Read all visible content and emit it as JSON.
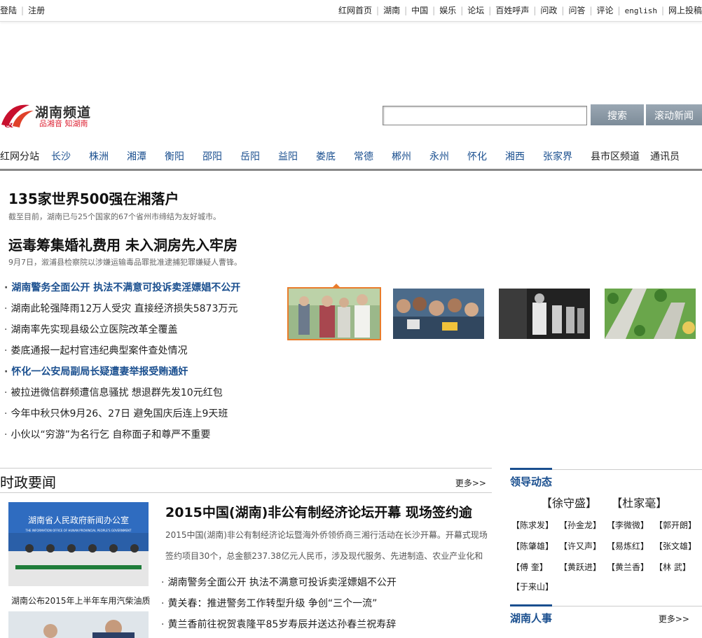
{
  "topbar": {
    "left": [
      "登陆",
      "注册"
    ],
    "right": [
      "红网首页",
      "湖南",
      "中国",
      "娱乐",
      "论坛",
      "百姓呼声",
      "问政",
      "问答",
      "评论",
      "english",
      "网上投稿"
    ]
  },
  "logo": {
    "title": "湖南频道",
    "slogan": "品湘音  知湖南"
  },
  "search": {
    "value": "",
    "search_btn": "搜索",
    "scroll_btn": "滚动新闻"
  },
  "citynav": {
    "label": "红网分站",
    "cities": [
      "长沙",
      "株洲",
      "湘潭",
      "衡阳",
      "邵阳",
      "岳阳",
      "益阳",
      "娄底",
      "常德",
      "郴州",
      "永州",
      "怀化",
      "湘西",
      "张家界"
    ],
    "extra": [
      "县市区频道",
      "通讯员"
    ]
  },
  "headlines": [
    {
      "title": "135家世界500强在湘落户",
      "sub": "截至目前，湖南已与25个国家的67个省州市缔结为友好城市。"
    },
    {
      "title": "运毒筹集婚礼费用 未入洞房先入牢房",
      "sub": "9月7日，溆浦县检察院以涉嫌运输毒品罪批准逮捕犯罪嫌疑人曹锋。"
    }
  ],
  "newslist": [
    {
      "text": "湖南警务全面公开  执法不满意可投诉卖淫嫖娼不公开",
      "highlight": true
    },
    {
      "text": "湖南此轮强降雨12万人受灾  直接经济损失5873万元",
      "highlight": false
    },
    {
      "text": "湖南率先实现县级公立医院改革全覆盖",
      "highlight": false
    },
    {
      "text": "娄底通报一起村官违纪典型案件查处情况",
      "highlight": false
    },
    {
      "text": "怀化一公安局副局长疑遭妻举报受贿通奸",
      "highlight": true
    },
    {
      "text": "被拉进微信群频遭信息骚扰  想退群先发10元红包",
      "highlight": false
    },
    {
      "text": "今年中秋只休9月26、27日  避免国庆后连上9天班",
      "highlight": false
    },
    {
      "text": "小伙以“穷游”为名行乞  自称面子和尊严不重要",
      "highlight": false
    }
  ],
  "section": {
    "title": "时政要闻",
    "more": "更多>>",
    "lead_title": "2015中国(湖南)非公有制经济论坛开幕  现场签约逾",
    "lead_body": "2015中国(湖南)非公有制经济论坛暨海外侨领侨商三湘行活动在长沙开幕。开幕式现场签约项目30个，总金额237.38亿元人民币，涉及现代服务、先进制造、农业产业化和",
    "photo_caption": "湖南公布2015年上半年车用汽柴油质",
    "list": [
      "湖南警务全面公开  执法不满意可投诉卖淫嫖娼不公开",
      "黄关春：推进警务工作转型升级  争创“三个一流”",
      "黄兰香前往祝贺袁隆平85岁寿辰并送达孙春兰祝寿辞"
    ],
    "photo_banner": "湖南省人民政府新闻办公室",
    "photo_banner_en": "THE INFORMATION OFFICE OF HUNAN PROVINCIAL PEOPLE'S GOVERNMENT"
  },
  "leaders": {
    "title": "领导动态",
    "big": [
      "【徐守盛】",
      "【杜家毫】"
    ],
    "names": [
      "【陈求发】",
      "【孙金龙】",
      "【李微微】",
      "【郭开朗】",
      "【陈肇雄】",
      "【许又声】",
      "【易炼红】",
      "【张文雄】",
      "【傅  奎】",
      "【黄跃进】",
      "【黄兰香】",
      "【林  武】",
      "【于来山】"
    ]
  },
  "personnel": {
    "title": "湖南人事",
    "more": "更多>>"
  }
}
